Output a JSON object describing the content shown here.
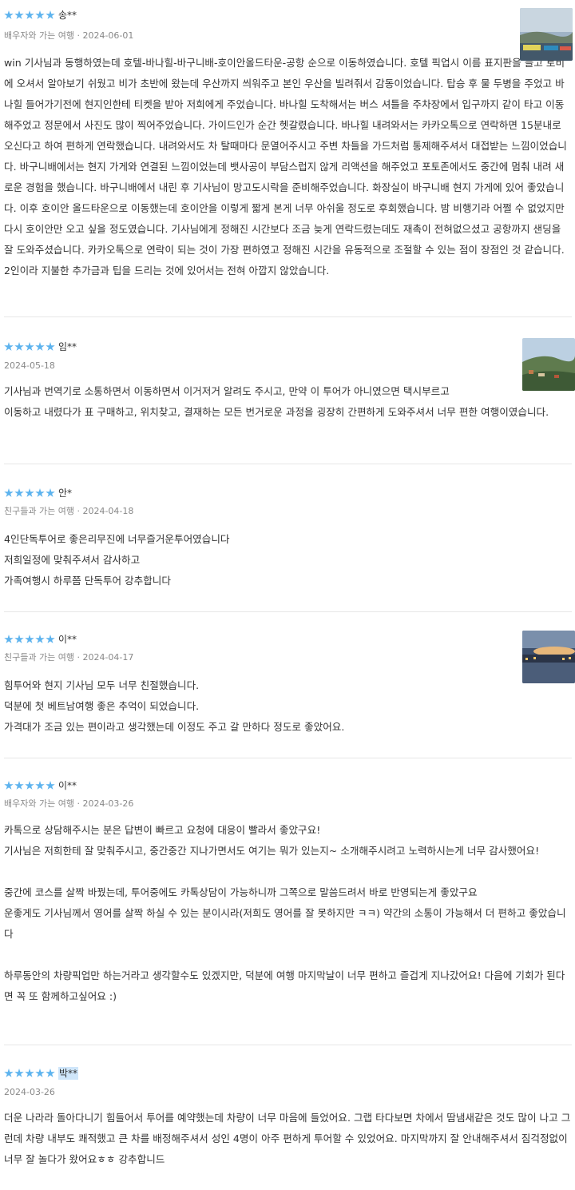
{
  "reviews": [
    {
      "name": "송**",
      "meta": "배우자와 가는 여행 · 2024-06-01",
      "body": "win 기사님과 동행하였는데 호텔-바나힐-바구니배-호이안올드타운-공항 순으로 이동하였습니다. 호텔 픽업시 이름 표지판을 들고 로비에 오셔서 알아보기 쉬웠고 비가 초반에 왔는데 우산까지 씌워주고 본인 우산을 빌려줘서 감동이었습니다. 탑승 후 물 두병을 주었고 바나힐 들어가기전에 현지인한테 티켓을 받아 저희에게 주었습니다. 바나힐 도착해서는 버스 셔틀을 주차장에서 입구까지 같이 타고 이동해주었고 정문에서 사진도 많이 찍어주었습니다. 가이드인가 순간 헷갈렸습니다. 바나힐 내려와서는 카카오톡으로 연락하면 15분내로 오신다고 하여 편하게 연락했습니다. 내려와서도 차 탈때마다 문열어주시고 주변 차들을 가드처럼 통제해주셔서 대접받는 느낌이었습니다. 바구니배에서는 현지 가게와 연결된 느낌이었는데 뱃사공이 부담스럽지 않게 리액션을 해주었고 포토존에서도 중간에 멈춰 내려 새로운 경험을 했습니다. 바구니배에서 내린 후 기사님이 망고도시락을 준비해주었습니다. 화장실이 바구니배 현지 가게에 있어 좋았습니다. 이후 호이안 올드타운으로 이동했는데 호이안을 이렇게 짧게 본게 너무 아쉬울 정도로 후회했습니다. 밤 비행기라 어쩔 수 없었지만 다시 호이안만 오고 싶을 정도였습니다. 기사님에게 정해진 시간보다 조금 늦게 연락드렸는데도 재촉이 전혀없으셨고 공항까지 샌딩을 잘 도와주셨습니다. 카카오톡으로 연락이 되는 것이 가장 편하였고 정해진 시간을 유동적으로 조절할 수 있는 점이 장점인 것 같습니다. 2인이라 지불한 추가금과 팁을 드리는 것에 있어서는 전혀 아깝지 않았습니다."
    },
    {
      "name": "임**",
      "meta": "2024-05-18",
      "body": "기사님과 번역기로 소통하면서 이동하면서 이거저거 알려도 주시고, 만약 이 투어가 아니였으면 택시부르고\n이동하고 내렸다가 표 구매하고, 위치찾고, 결재하는 모든 번거로운 과정을 굉장히 간편하게 도와주셔서 너무 편한 여행이였습니다."
    },
    {
      "name": "안*",
      "meta": "친구들과 가는 여행 · 2024-04-18",
      "body": "4인단독투어로 좋은리무진에 너무즐거운투어였습니다\n저희일정에 맞춰주셔서 감사하고\n가족여행시 하루쯤 단독투어 강추합니다"
    },
    {
      "name": "이**",
      "meta": "친구들과 가는 여행 · 2024-04-17",
      "body": "힘투어와 현지 기사님 모두 너무 친절했습니다.\n덕분에 첫 베트남여행 좋은 추억이 되었습니다.\n가격대가 조금 있는 편이라고 생각했는데 이정도 주고 갈 만하다 정도로 좋았어요."
    },
    {
      "name": "이**",
      "meta": "배우자와 가는 여행 · 2024-03-26",
      "body": "카톡으로 상담해주시는 분은 답변이 빠르고 요청에 대응이 빨라서 좋았구요!\n기사님은 저희한테 잘 맞춰주시고, 중간중간 지나가면서도 여기는 뭐가 있는지~ 소개해주시려고 노력하시는게 너무 감사했어요!\n\n중간에 코스를 살짝 바꿨는데, 투어중에도 카톡상담이 가능하니까 그쪽으로 말씀드려서 바로 반영되는게 좋았구요\n운좋게도 기사님께서 영어를 살짝 하실 수 있는 분이시라(저희도 영어를 잘 못하지만 ㅋㅋ) 약간의 소통이 가능해서 더 편하고 좋았습니다\n\n하루동안의 차량픽업만 하는거라고 생각할수도 있겠지만, 덕분에 여행 마지막날이 너무 편하고 즐겁게 지나갔어요! 다음에 기회가 된다면 꼭 또 함께하고싶어요 :)"
    },
    {
      "name": "박**",
      "meta": "2024-03-26",
      "body": "더운 나라라 돌아다니기 힘들어서 투어를 예약했는데 차량이 너무 마음에 들었어요. 그랩 타다보면 차에서 땀냄새같은 것도 많이 나고 그런데 차량 내부도 쾌적했고 큰 차를 배정해주셔서 성인 4명이 아주 편하게 투어할 수 있었어요. 마지막까지 잘 안내해주셔서 짐걱정없이 너무 잘 놀다가 왔어요ㅎㅎ 강추합니드"
    }
  ],
  "colors": {
    "star": "#5db3ee",
    "divider": "#e7e7e7",
    "highlight": "#cfe6fa"
  }
}
